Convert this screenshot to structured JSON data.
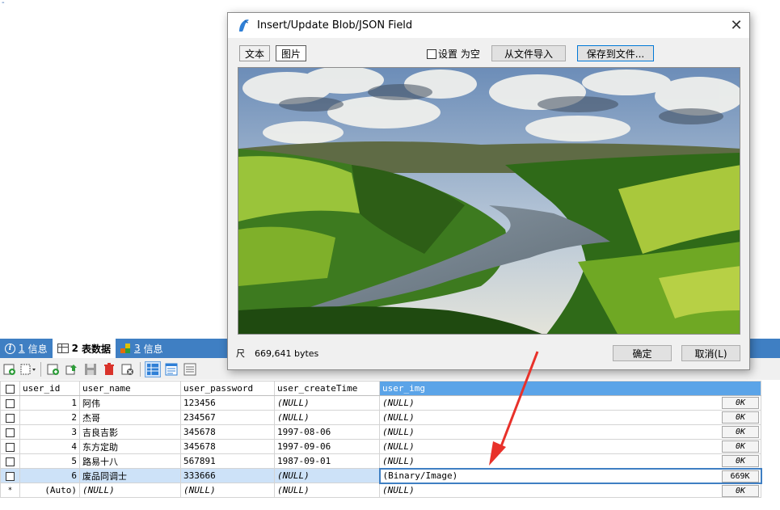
{
  "corner_mark": "-",
  "dialog": {
    "title": "Insert/Update Blob/JSON Field",
    "close_glyph": "✕",
    "tab_text": "文本",
    "tab_image": "图片",
    "null_checkbox_label": "设置 为空",
    "import_button": "从文件导入",
    "save_button": "保存到文件...",
    "size_glyph": "尺",
    "size_text": "669,641 bytes",
    "ok_button": "确定",
    "cancel_button": "取消(L)"
  },
  "tabs": [
    {
      "num": "1",
      "label": "信息"
    },
    {
      "num": "2",
      "label": "表数据"
    },
    {
      "num": "3",
      "label": "信息"
    }
  ],
  "grid": {
    "columns": [
      "user_id",
      "user_name",
      "user_password",
      "user_createTime",
      "user_img"
    ],
    "rows": [
      {
        "id": "1",
        "name": "阿伟",
        "password": "123456",
        "createTime": "(NULL)",
        "img": "(NULL)",
        "size": "0K"
      },
      {
        "id": "2",
        "name": "杰哥",
        "password": "234567",
        "createTime": "(NULL)",
        "img": "(NULL)",
        "size": "0K"
      },
      {
        "id": "3",
        "name": "吉良吉影",
        "password": "345678",
        "createTime": "1997-08-06",
        "img": "(NULL)",
        "size": "0K"
      },
      {
        "id": "4",
        "name": "东方定助",
        "password": "345678",
        "createTime": "1997-09-06",
        "img": "(NULL)",
        "size": "0K"
      },
      {
        "id": "5",
        "name": "路易十八",
        "password": "567891",
        "createTime": "1987-09-01",
        "img": "(NULL)",
        "size": "0K"
      },
      {
        "id": "6",
        "name": "废品同调士",
        "password": "333666",
        "createTime": "(NULL)",
        "img": "(Binary/Image)",
        "size": "669K"
      }
    ],
    "new_row": {
      "mark": "*",
      "id": "(Auto)",
      "name": "(NULL)",
      "password": "(NULL)",
      "createTime": "(NULL)",
      "img": "(NULL)",
      "size": "0K"
    }
  },
  "colors": {
    "tab_bar": "#3f7fc3",
    "selected_column_header": "#5ba4e8",
    "selected_row": "#cde2f8",
    "annotation_arrow": "#e8312a"
  },
  "icons": {
    "tab1": "info-icon",
    "tab2": "table-icon",
    "tab3": "blocks-icon",
    "dialog": "dolphin-icon",
    "size": "ruler-icon"
  }
}
